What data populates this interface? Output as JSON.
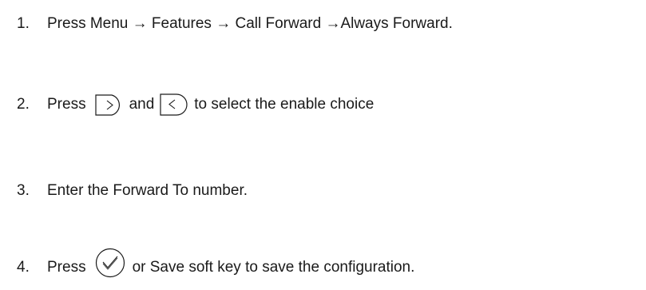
{
  "steps": [
    {
      "number": "1.",
      "text": "Press Menu → Features → Call Forward →Always Forward."
    },
    {
      "number": "2.",
      "press": "Press",
      "right_key_icon": "right-arrow-key-icon",
      "and": "and",
      "left_key_icon": "left-arrow-key-icon",
      "rest": "to select the enable choice"
    },
    {
      "number": "3.",
      "text": "Enter the Forward To number."
    },
    {
      "number": "4.",
      "press": "Press",
      "ok_key_icon": "ok-checkmark-key-icon",
      "rest": "or Save soft key to save the configuration."
    }
  ]
}
